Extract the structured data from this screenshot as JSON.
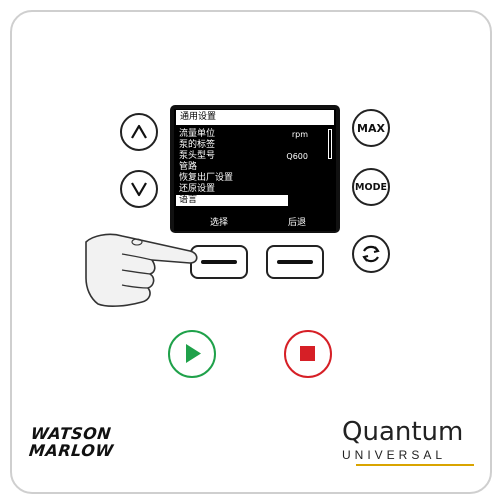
{
  "screen": {
    "title": "通用设置",
    "menu": [
      {
        "label": "流量单位",
        "value": "rpm"
      },
      {
        "label": "泵的标签",
        "value": ""
      },
      {
        "label": "泵头型号",
        "value": "Q600"
      },
      {
        "label": "管路",
        "value": ""
      },
      {
        "label": "恢复出厂设置",
        "value": ""
      },
      {
        "label": "还原设置",
        "value": ""
      },
      {
        "label": "语言",
        "value": ""
      }
    ],
    "selected_index": 6,
    "softkey_left": "选择",
    "softkey_right": "后退"
  },
  "buttons": {
    "max_label": "MAX",
    "mode_label": "MODE"
  },
  "brand": {
    "left_line1": "WATSON",
    "left_line2": "MARLOW",
    "right_main": "Quantum",
    "right_sub": "UNIVERSAL"
  },
  "colors": {
    "start": "#1fa14a",
    "stop": "#d61f26",
    "accent": "#d9a400"
  }
}
